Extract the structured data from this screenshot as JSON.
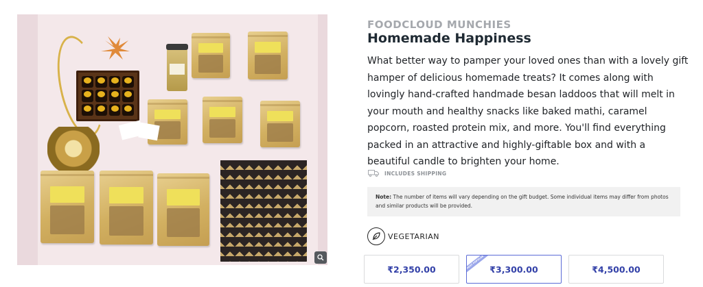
{
  "product": {
    "brand": "FOODCLOUD MUNCHIES",
    "title": "Homemade Happiness",
    "description": "What better way to pamper your loved ones than with a lovely gift hamper of delicious homemade treats? It comes along with lovingly hand-crafted handmade besan laddoos that will melt in your mouth and healthy snacks like baked mathi, caramel popcorn, roasted protein mix, and more. You'll find everything packed in an attractive and highly-giftable box and with a beautiful candle to brighten your home.",
    "shipping_label": "INCLUDES SHIPPING",
    "note_label": "Note:",
    "note_text": " The number of items will vary depending on the gift budget. Some individual items may differ from photos and similar products will be provided.",
    "diet_label": "VEGETARIAN"
  },
  "image": {
    "alt": "Gift hamper with laddoo box, jars, snack pouches, candle and patterned gift box",
    "zoom_icon": "magnifier-icon"
  },
  "prices": [
    {
      "label": "₹2,350.00",
      "selected": false
    },
    {
      "label": "₹3,300.00",
      "selected": true,
      "tag": "MOST POPULAR"
    },
    {
      "label": "₹4,500.00",
      "selected": false
    }
  ],
  "icons": {
    "shipping": "truck-icon",
    "diet": "leaf-icon"
  },
  "colors": {
    "price_text": "#3341a8",
    "selected_border": "#5a6ad6",
    "brand_text": "#a5a8ad"
  }
}
